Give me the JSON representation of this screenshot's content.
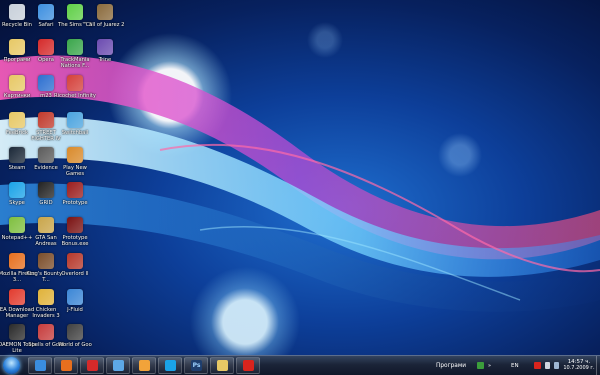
{
  "desktop": {
    "icons": [
      {
        "label": "Recycle Bin",
        "icon": "recycle-bin-icon",
        "color": "#c8d0da"
      },
      {
        "label": "Safari",
        "icon": "safari-icon",
        "color": "#3d8fe0"
      },
      {
        "label": "The Sims™ 3",
        "icon": "sims3-icon",
        "color": "#5fcf47"
      },
      {
        "label": "Call of Juarez 2",
        "icon": "call-of-juarez-icon",
        "color": "#8a6a3c"
      },
      {
        "label": "Програми",
        "icon": "folder-icon",
        "color": "#e7c865"
      },
      {
        "label": "Opera",
        "icon": "opera-icon",
        "color": "#d52a2a"
      },
      {
        "label": "TrackMania Nations F...",
        "icon": "trackmania-icon",
        "color": "#3aa64b"
      },
      {
        "label": "Trine",
        "icon": "trine-icon",
        "color": "#6b4bb0"
      },
      {
        "label": "Картинки",
        "icon": "folder-icon",
        "color": "#e7c865"
      },
      {
        "label": "m23",
        "icon": "m23-icon",
        "color": "#2c6fd0"
      },
      {
        "label": "Ricochet Infinity",
        "icon": "ricochet-icon",
        "color": "#d4403a"
      },
      {
        "label": "FeeBrick",
        "icon": "folder-icon",
        "color": "#e7c865"
      },
      {
        "label": "STREET FIGHTER IV",
        "icon": "street-fighter-icon",
        "color": "#c0392b"
      },
      {
        "label": "Switchball",
        "icon": "switchball-icon",
        "color": "#4aa3df"
      },
      {
        "label": "Steam",
        "icon": "steam-icon",
        "color": "#1b2838"
      },
      {
        "label": "Evidence",
        "icon": "evidence-icon",
        "color": "#5b5b5b"
      },
      {
        "label": "Play New Games",
        "icon": "play-new-games-icon",
        "color": "#d98a2b"
      },
      {
        "label": "Skype",
        "icon": "skype-icon",
        "color": "#1aa3e8"
      },
      {
        "label": "GRID",
        "icon": "grid-icon",
        "color": "#222222"
      },
      {
        "label": "Prototype",
        "icon": "prototype-icon",
        "color": "#9b1d1d"
      },
      {
        "label": "Notepad++",
        "icon": "notepad-plus-icon",
        "color": "#7fbf3f"
      },
      {
        "label": "GTA San Andreas",
        "icon": "gta-icon",
        "color": "#c9a54a"
      },
      {
        "label": "Prototype Bonus.exe",
        "icon": "prototype-bonus-icon",
        "color": "#7a1212"
      },
      {
        "label": "Mozilla Firefox 3...",
        "icon": "firefox-icon",
        "color": "#e76f1e"
      },
      {
        "label": "King's Bounty - T...",
        "icon": "kings-bounty-icon",
        "color": "#7b4d2a"
      },
      {
        "label": "Overlord II",
        "icon": "overlord-icon",
        "color": "#b5372a"
      },
      {
        "label": "EA Download Manager",
        "icon": "ea-download-manager-icon",
        "color": "#e23b2e"
      },
      {
        "label": "Chicken Invaders 3",
        "icon": "chicken-invaders-icon",
        "color": "#e0b23a"
      },
      {
        "label": "J-Fluid",
        "icon": "j-fluid-icon",
        "color": "#3b86d6"
      },
      {
        "label": "DAEMON Tools Lite",
        "icon": "daemon-tools-icon",
        "color": "#2a2a2a"
      },
      {
        "label": "Spells of Gold",
        "icon": "spells-of-gold-icon",
        "color": "#c63c3c"
      },
      {
        "label": "World of Goo",
        "icon": "world-of-goo-icon",
        "color": "#404040"
      }
    ]
  },
  "taskbar": {
    "pinned": [
      {
        "name": "internet-explorer-icon",
        "color": "#3a8de0"
      },
      {
        "name": "firefox-icon",
        "color": "#e76f1e"
      },
      {
        "name": "opera-icon",
        "color": "#d52a2a"
      },
      {
        "name": "windows-explorer-icon",
        "color": "#5da8e6"
      },
      {
        "name": "media-player-icon",
        "color": "#f2a33a"
      },
      {
        "name": "skype-icon",
        "color": "#1aa3e8"
      },
      {
        "name": "photoshop-icon",
        "color": "#1e3e6e",
        "text": "Ps"
      },
      {
        "name": "folder-icon",
        "color": "#e7c865"
      },
      {
        "name": "red-app-icon",
        "color": "#d9241d"
      }
    ],
    "toolbar_label": "Програми",
    "language": "EN",
    "time": "14:57 ч.",
    "date": "10.7.2009 г."
  }
}
